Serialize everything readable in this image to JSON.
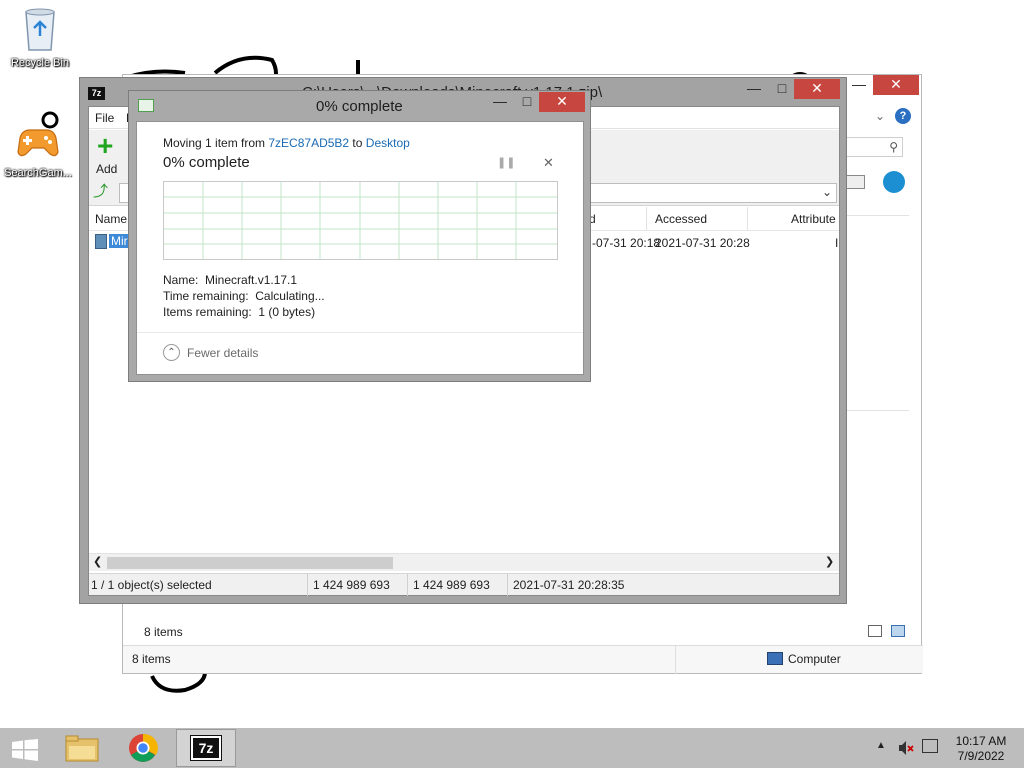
{
  "desktop": {
    "icons": [
      {
        "label": "Recycle Bin"
      },
      {
        "label": "SearchGam..."
      }
    ]
  },
  "explorer": {
    "status_items_top": "8 items",
    "status_items_bottom": "8 items",
    "status_location": "Computer"
  },
  "sevenzip": {
    "title": "C:\\Users\\...\\Downloads\\Minecraft.v1.17.1.zip\\",
    "menu_file": "File",
    "menu_edit": "E",
    "add_label": "Add",
    "columns": {
      "name": "Name",
      "modified": "d",
      "accessed": "Accessed",
      "attributes": "Attribute"
    },
    "row": {
      "name": "Mir",
      "modified": "-07-31 20:18",
      "accessed": "2021-07-31 20:28",
      "attributes": "I"
    },
    "status": {
      "selected": "1 / 1 object(s) selected",
      "size": "1 424 989 693",
      "packed": "1 424 989 693",
      "date": "2021-07-31 20:28:35"
    }
  },
  "dialog": {
    "title": "0% complete",
    "moving_prefix": "Moving 1 item from ",
    "source": "7zEC87AD5B2",
    "moving_to": " to ",
    "destination": "Desktop",
    "heading": "0% complete",
    "progress": 0,
    "name_label": "Name:",
    "name_value": "Minecraft.v1.17.1",
    "time_label": "Time remaining:",
    "time_value": "Calculating...",
    "items_label": "Items remaining:",
    "items_value": "1 (0 bytes)",
    "fewer_details": "Fewer details"
  },
  "taskbar": {
    "time": "10:17 AM",
    "date": "7/9/2022",
    "sevenzip_label": "7z"
  },
  "colors": {
    "link": "#1a6ab3",
    "close": "#c7463f",
    "grid_line": "#bfe6c9",
    "taskbar": "#bdbdbd"
  }
}
